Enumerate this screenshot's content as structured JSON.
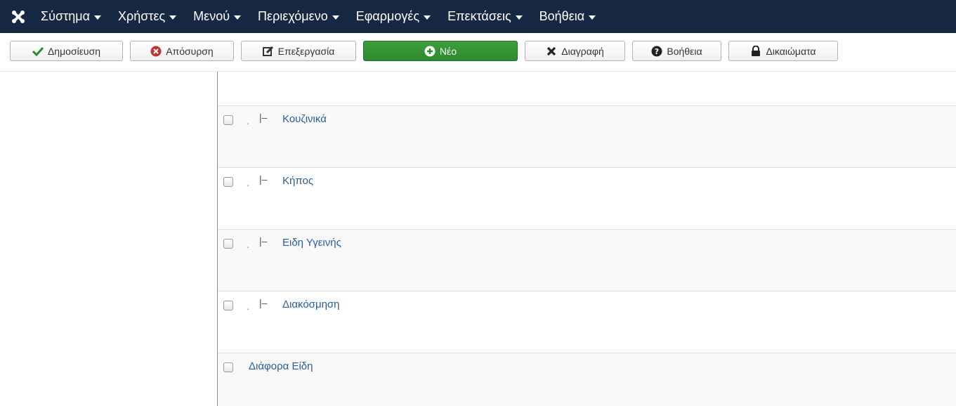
{
  "nav": {
    "items": [
      {
        "label": "Σύστημα"
      },
      {
        "label": "Χρήστες"
      },
      {
        "label": "Μενού"
      },
      {
        "label": "Περιεχόμενο"
      },
      {
        "label": "Εφαρμογές"
      },
      {
        "label": "Επεκτάσεις"
      },
      {
        "label": "Βοήθεια"
      }
    ]
  },
  "toolbar": {
    "publish": "Δημοσίευση",
    "unpublish": "Απόσυρση",
    "edit": "Επεξεργασία",
    "new": "Νέο",
    "delete": "Διαγραφή",
    "help": "Βοήθεια",
    "permissions": "Δικαιώματα"
  },
  "rows": [
    {
      "prefix": ".",
      "tree": "|–",
      "title": "Κουζινικά"
    },
    {
      "prefix": ".",
      "tree": "|–",
      "title": "Κήπος"
    },
    {
      "prefix": ".",
      "tree": "|–",
      "title": "Ειδη Υγεινής"
    },
    {
      "prefix": ".",
      "tree": "|–",
      "title": "Διακόσμηση"
    },
    {
      "prefix": "",
      "tree": "",
      "title": "Διάφορα Είδη"
    }
  ],
  "colors": {
    "navbar": "#172942",
    "link": "#2a5c9a",
    "success": "#2d8a2d"
  }
}
